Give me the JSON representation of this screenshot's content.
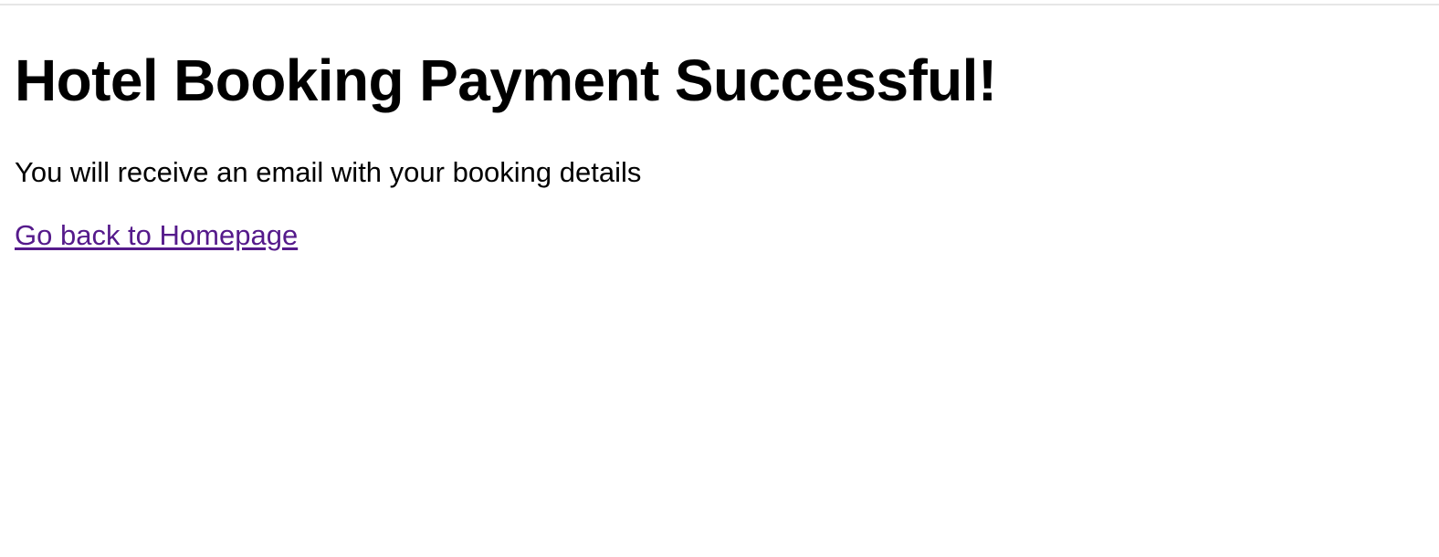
{
  "page": {
    "title": "Hotel Booking Payment Successful!",
    "message": "You will receive an email with your booking details",
    "home_link_label": "Go back to Homepage"
  },
  "colors": {
    "background": "#ffffff",
    "text": "#000000",
    "visited_link": "#551a8b",
    "top_rule": "#e6e6e6"
  }
}
